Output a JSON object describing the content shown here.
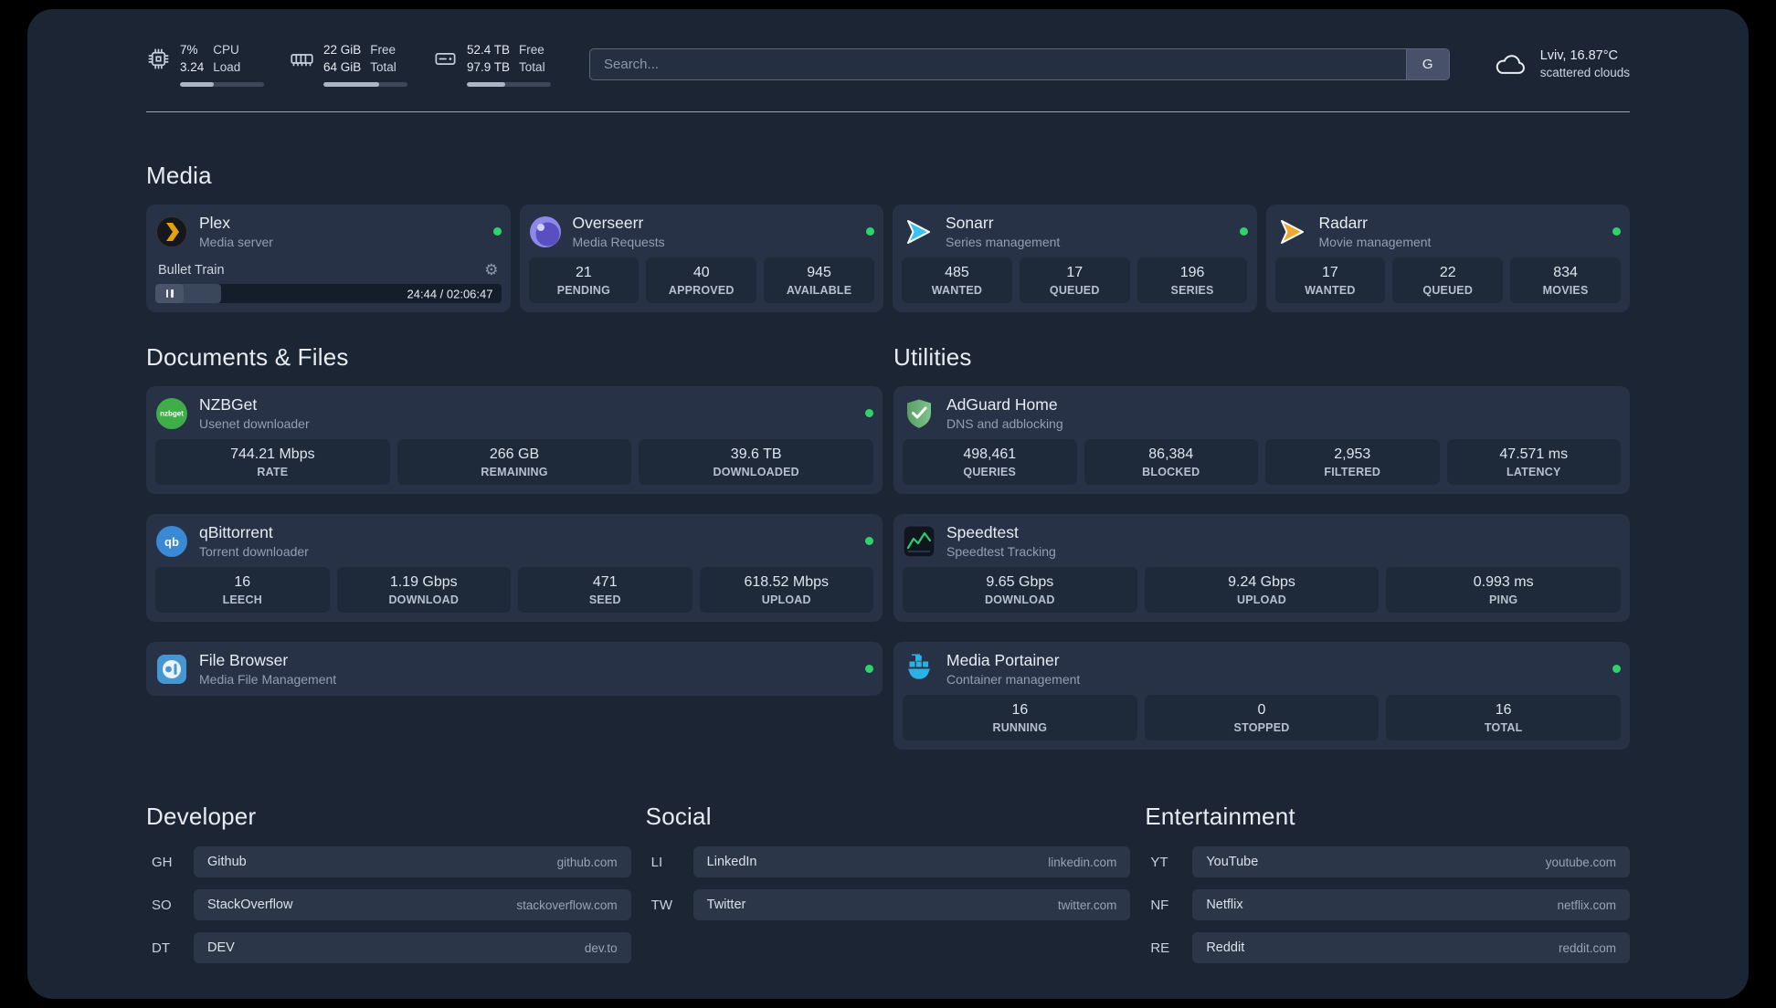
{
  "topbar": {
    "cpu": {
      "value1": "7%",
      "value2": "3.24",
      "label1": "CPU",
      "label2": "Load",
      "fill": 40
    },
    "memory": {
      "value1": "22 GiB",
      "value2": "64 GiB",
      "label1": "Free",
      "label2": "Total",
      "fill": 66
    },
    "disk": {
      "value1": "52.4 TB",
      "value2": "97.9 TB",
      "label1": "Free",
      "label2": "Total",
      "fill": 46
    },
    "search": {
      "placeholder": "Search...",
      "provider": "G"
    },
    "weather": {
      "location": "Lviv, 16.87°C",
      "condition": "scattered clouds"
    }
  },
  "icons": {
    "gear": "⚙"
  },
  "groups": {
    "media": {
      "title": "Media",
      "plex": {
        "name": "Plex",
        "subtitle": "Media server",
        "player": {
          "track": "Bullet Train",
          "time": "24:44 / 02:06:47",
          "progress": 19
        }
      },
      "overseerr": {
        "name": "Overseerr",
        "subtitle": "Media Requests",
        "stats": [
          {
            "value": "21",
            "label": "PENDING"
          },
          {
            "value": "40",
            "label": "APPROVED"
          },
          {
            "value": "945",
            "label": "AVAILABLE"
          }
        ]
      },
      "sonarr": {
        "name": "Sonarr",
        "subtitle": "Series management",
        "stats": [
          {
            "value": "485",
            "label": "WANTED"
          },
          {
            "value": "17",
            "label": "QUEUED"
          },
          {
            "value": "196",
            "label": "SERIES"
          }
        ]
      },
      "radarr": {
        "name": "Radarr",
        "subtitle": "Movie management",
        "stats": [
          {
            "value": "17",
            "label": "WANTED"
          },
          {
            "value": "22",
            "label": "QUEUED"
          },
          {
            "value": "834",
            "label": "MOVIES"
          }
        ]
      }
    },
    "documents": {
      "title": "Documents & Files",
      "nzbget": {
        "name": "NZBGet",
        "subtitle": "Usenet downloader",
        "stats": [
          {
            "value": "744.21 Mbps",
            "label": "RATE"
          },
          {
            "value": "266 GB",
            "label": "REMAINING"
          },
          {
            "value": "39.6 TB",
            "label": "DOWNLOADED"
          }
        ]
      },
      "qbittorrent": {
        "name": "qBittorrent",
        "subtitle": "Torrent downloader",
        "stats": [
          {
            "value": "16",
            "label": "LEECH"
          },
          {
            "value": "1.19 Gbps",
            "label": "DOWNLOAD"
          },
          {
            "value": "471",
            "label": "SEED"
          },
          {
            "value": "618.52 Mbps",
            "label": "UPLOAD"
          }
        ]
      },
      "filebrowser": {
        "name": "File Browser",
        "subtitle": "Media File Management"
      }
    },
    "utilities": {
      "title": "Utilities",
      "adguard": {
        "name": "AdGuard Home",
        "subtitle": "DNS and adblocking",
        "stats": [
          {
            "value": "498,461",
            "label": "QUERIES"
          },
          {
            "value": "86,384",
            "label": "BLOCKED"
          },
          {
            "value": "2,953",
            "label": "FILTERED"
          },
          {
            "value": "47.571 ms",
            "label": "LATENCY"
          }
        ]
      },
      "speedtest": {
        "name": "Speedtest",
        "subtitle": "Speedtest Tracking",
        "stats": [
          {
            "value": "9.65 Gbps",
            "label": "DOWNLOAD"
          },
          {
            "value": "9.24 Gbps",
            "label": "UPLOAD"
          },
          {
            "value": "0.993 ms",
            "label": "PING"
          }
        ]
      },
      "portainer": {
        "name": "Media Portainer",
        "subtitle": "Container management",
        "stats": [
          {
            "value": "16",
            "label": "RUNNING"
          },
          {
            "value": "0",
            "label": "STOPPED"
          },
          {
            "value": "16",
            "label": "TOTAL"
          }
        ]
      }
    }
  },
  "bookmarks": {
    "developer": {
      "title": "Developer",
      "items": [
        {
          "abbr": "GH",
          "name": "Github",
          "domain": "github.com"
        },
        {
          "abbr": "SO",
          "name": "StackOverflow",
          "domain": "stackoverflow.com"
        },
        {
          "abbr": "DT",
          "name": "DEV",
          "domain": "dev.to"
        }
      ]
    },
    "social": {
      "title": "Social",
      "items": [
        {
          "abbr": "LI",
          "name": "LinkedIn",
          "domain": "linkedin.com"
        },
        {
          "abbr": "TW",
          "name": "Twitter",
          "domain": "twitter.com"
        }
      ]
    },
    "entertainment": {
      "title": "Entertainment",
      "items": [
        {
          "abbr": "YT",
          "name": "YouTube",
          "domain": "youtube.com"
        },
        {
          "abbr": "NF",
          "name": "Netflix",
          "domain": "netflix.com"
        },
        {
          "abbr": "RE",
          "name": "Reddit",
          "domain": "reddit.com"
        }
      ]
    }
  }
}
